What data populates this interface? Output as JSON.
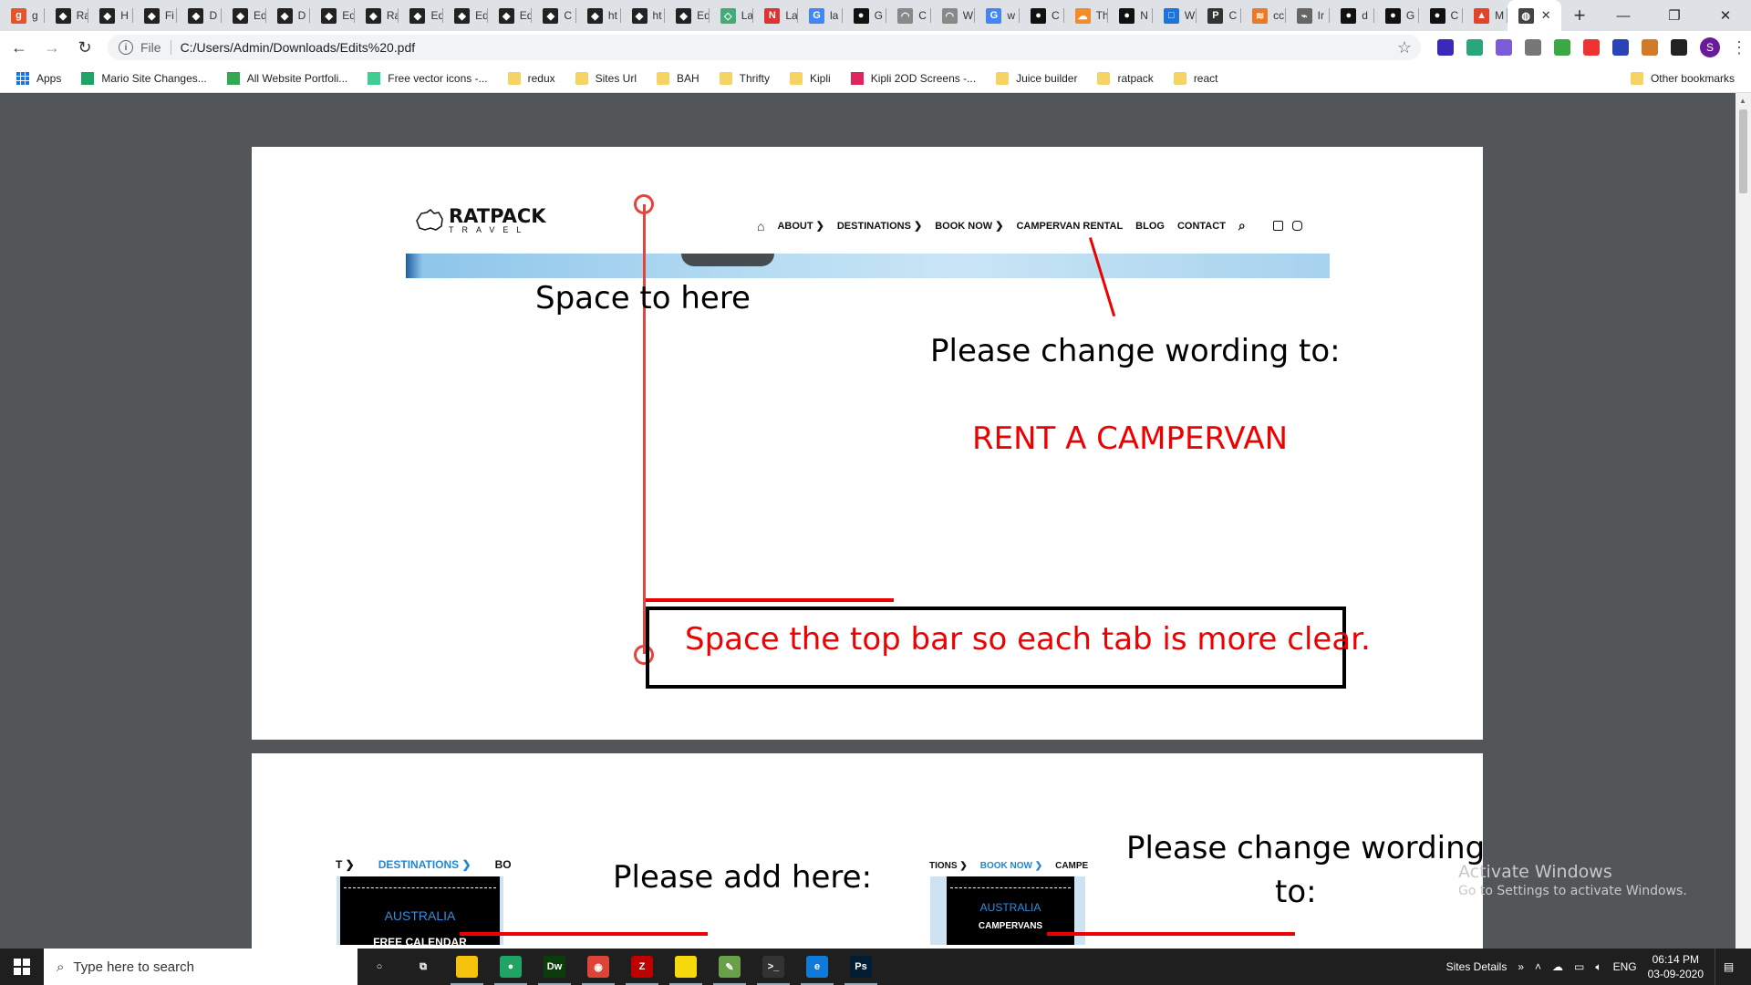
{
  "browser": {
    "tabs": [
      {
        "title": "g",
        "color": "#e8542a",
        "glyph": "g"
      },
      {
        "title": "Ra",
        "color": "#222",
        "glyph": "◆"
      },
      {
        "title": "H",
        "color": "#222",
        "glyph": "◆"
      },
      {
        "title": "Fi",
        "color": "#222",
        "glyph": "◆"
      },
      {
        "title": "D",
        "color": "#222",
        "glyph": "◆"
      },
      {
        "title": "Ed",
        "color": "#222",
        "glyph": "◆"
      },
      {
        "title": "D",
        "color": "#222",
        "glyph": "◆"
      },
      {
        "title": "Ed",
        "color": "#222",
        "glyph": "◆"
      },
      {
        "title": "Ra",
        "color": "#222",
        "glyph": "◆"
      },
      {
        "title": "Ed",
        "color": "#222",
        "glyph": "◆"
      },
      {
        "title": "Ed",
        "color": "#222",
        "glyph": "◆"
      },
      {
        "title": "Ed",
        "color": "#222",
        "glyph": "◆"
      },
      {
        "title": "C",
        "color": "#222",
        "glyph": "◆"
      },
      {
        "title": "ht",
        "color": "#222",
        "glyph": "◆"
      },
      {
        "title": "ht",
        "color": "#222",
        "glyph": "◆"
      },
      {
        "title": "Ed",
        "color": "#222",
        "glyph": "◆"
      },
      {
        "title": "La",
        "color": "#4a7",
        "glyph": "◇"
      },
      {
        "title": "La",
        "color": "#d33",
        "glyph": "N"
      },
      {
        "title": "la",
        "color": "#4285f4",
        "glyph": "G"
      },
      {
        "title": "G",
        "color": "#111",
        "glyph": "●"
      },
      {
        "title": "C",
        "color": "#888",
        "glyph": "◠"
      },
      {
        "title": "W",
        "color": "#888",
        "glyph": "◠"
      },
      {
        "title": "w",
        "color": "#4285f4",
        "glyph": "G"
      },
      {
        "title": "C",
        "color": "#111",
        "glyph": "●"
      },
      {
        "title": "Th",
        "color": "#f28c28",
        "glyph": "☁"
      },
      {
        "title": "N",
        "color": "#111",
        "glyph": "●"
      },
      {
        "title": "W",
        "color": "#1e73d8",
        "glyph": "□"
      },
      {
        "title": "C",
        "color": "#333",
        "glyph": "P"
      },
      {
        "title": "cc",
        "color": "#e87a2a",
        "glyph": "≋"
      },
      {
        "title": "Ir",
        "color": "#666",
        "glyph": "⌁"
      },
      {
        "title": "d",
        "color": "#111",
        "glyph": "●"
      },
      {
        "title": "G",
        "color": "#111",
        "glyph": "●"
      },
      {
        "title": "C",
        "color": "#111",
        "glyph": "●"
      },
      {
        "title": "M",
        "color": "#e24329",
        "glyph": "▲"
      }
    ],
    "active_tab": {
      "title": "",
      "glyph": "◍",
      "close": "✕"
    },
    "new_tab": "+",
    "window_controls": {
      "minimize": "—",
      "restore": "❐",
      "close": "✕"
    },
    "nav": {
      "back": "←",
      "forward": "→",
      "reload": "↻"
    },
    "address": {
      "scheme": "File",
      "url": "C:/Users/Admin/Downloads/Edits%20.pdf",
      "info": "i",
      "star": "☆"
    },
    "extensions": [
      "#3b2ab8",
      "#2aa67a",
      "#7b5cd6",
      "#777",
      "#3aa845",
      "#e33",
      "#2a44b8",
      "#d07a2a",
      "#222"
    ],
    "profile_initial": "S",
    "menu": "⋮"
  },
  "bookmarks": {
    "apps": "Apps",
    "items": [
      {
        "label": "Mario Site Changes...",
        "kind": "green"
      },
      {
        "label": "All Website Portfoli...",
        "kind": "drive"
      },
      {
        "label": "Free vector icons -...",
        "kind": "vector"
      },
      {
        "label": "redux",
        "kind": "folder"
      },
      {
        "label": "Sites Url",
        "kind": "folder"
      },
      {
        "label": "BAH",
        "kind": "folder"
      },
      {
        "label": "Thrifty",
        "kind": "folder"
      },
      {
        "label": "Kipli",
        "kind": "folder"
      },
      {
        "label": "Kipli 2OD Screens -...",
        "kind": "invision"
      },
      {
        "label": "Juice builder",
        "kind": "folder"
      },
      {
        "label": "ratpack",
        "kind": "folder"
      },
      {
        "label": "react",
        "kind": "folder"
      }
    ],
    "other": "Other bookmarks"
  },
  "pdf": {
    "page1": {
      "logo_main": "RATPACK",
      "logo_sub": "TRAVEL",
      "nav": [
        "ABOUT ❯",
        "DESTINATIONS ❯",
        "BOOK NOW ❯",
        "CAMPERVAN RENTAL",
        "BLOG",
        "CONTACT"
      ],
      "home_icon": "⌂",
      "search_icon": "⌕",
      "annotation_space": "Space to here",
      "annotation_wording": "Please change wording to:",
      "annotation_new_wording": "RENT A CAMPERVAN",
      "annotation_box": "Space the top bar so each tab is more clear."
    },
    "page2": {
      "left_nav": [
        "T ❯",
        "DESTINATIONS ❯",
        "BO"
      ],
      "left_drop_title": "AUSTRALIA",
      "left_drop_item": "FREE CALENDAR",
      "annotation_add": "Please add here:",
      "right_nav": [
        "TIONS ❯",
        "BOOK NOW ❯",
        "CAMPE"
      ],
      "right_drop_title": "AUSTRALIA",
      "right_drop_item": "CAMPERVANS",
      "annotation_change_1": "Please change wording",
      "annotation_change_2": "to:"
    },
    "watermark_1": "Activate Windows",
    "watermark_2": "Go to Settings to activate Windows."
  },
  "taskbar": {
    "search_placeholder": "Type here to search",
    "apps": [
      {
        "name": "cortana",
        "glyph": "○",
        "color": "transparent"
      },
      {
        "name": "task-view",
        "glyph": "⧉",
        "color": "transparent"
      },
      {
        "name": "file-explorer",
        "glyph": "",
        "color": "#f4c20d"
      },
      {
        "name": "green-app",
        "glyph": "●",
        "color": "#1fa463"
      },
      {
        "name": "dreamweaver",
        "glyph": "Dw",
        "color": "#0b3d0b"
      },
      {
        "name": "chrome",
        "glyph": "◉",
        "color": "#db4437"
      },
      {
        "name": "filezilla",
        "glyph": "Z",
        "color": "#bf0000"
      },
      {
        "name": "sticky-notes",
        "glyph": "",
        "color": "#f5d90a"
      },
      {
        "name": "notepad",
        "glyph": "✎",
        "color": "#6a9f4a"
      },
      {
        "name": "terminal",
        "glyph": ">_",
        "color": "#333"
      },
      {
        "name": "edge",
        "glyph": "e",
        "color": "#0f7ad8"
      },
      {
        "name": "photoshop",
        "glyph": "Ps",
        "color": "#001d34"
      }
    ],
    "tray_label": "Sites Details",
    "language": "ENG",
    "time": "06:14 PM",
    "date": "03-09-2020"
  }
}
